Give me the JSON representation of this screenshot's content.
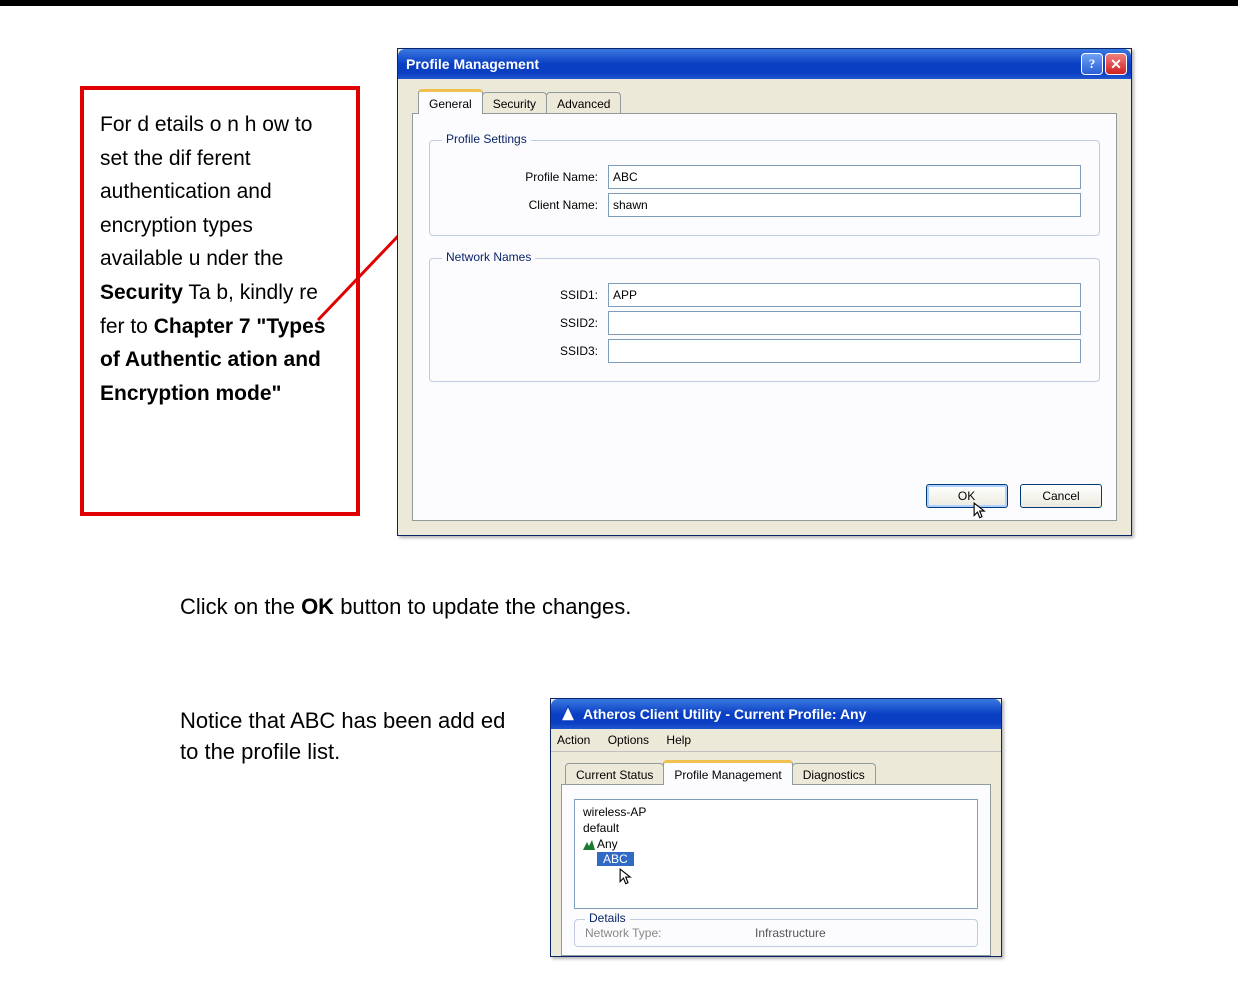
{
  "callout": {
    "text_a": "For d etails o n h ow to set the dif  ferent authentication and encryption types available u      nder the   ",
    "bold1": "Security",
    "text_b": " Ta   b, kindly re     fer to ",
    "bold2": "Chapter 7 \"Types of Authentic    ation and Encryption mode\""
  },
  "dialog": {
    "title": "Profile Management",
    "tabs": {
      "general": "General",
      "security": "Security",
      "advanced": "Advanced"
    },
    "group_profile": {
      "legend": "Profile Settings",
      "profile_name_label": "Profile Name:",
      "profile_name_value": "ABC",
      "client_name_label": "Client Name:",
      "client_name_value": "shawn"
    },
    "group_network": {
      "legend": "Network Names",
      "ssid1_label": "SSID1:",
      "ssid1_value": "APP",
      "ssid2_label": "SSID2:",
      "ssid2_value": "",
      "ssid3_label": "SSID3:",
      "ssid3_value": ""
    },
    "ok_label": "OK",
    "cancel_label": "Cancel"
  },
  "para1": {
    "a": "Click on the ",
    "b": "OK",
    "c": " button to update the changes."
  },
  "para2": "Notice that ABC has been    add ed to the profile list.",
  "util": {
    "title": "Atheros Client Utility - Current Profile: Any",
    "menu": {
      "action": "Action",
      "options": "Options",
      "help": "Help"
    },
    "tabs": {
      "status": "Current Status",
      "pm": "Profile Management",
      "diag": "Diagnostics"
    },
    "list": {
      "i1": "wireless-AP",
      "i2": "default",
      "i3": "Any",
      "i4": "ABC"
    },
    "details": {
      "legend": "Details",
      "k1": "Network Type:",
      "v1": "Infrastructure"
    }
  }
}
